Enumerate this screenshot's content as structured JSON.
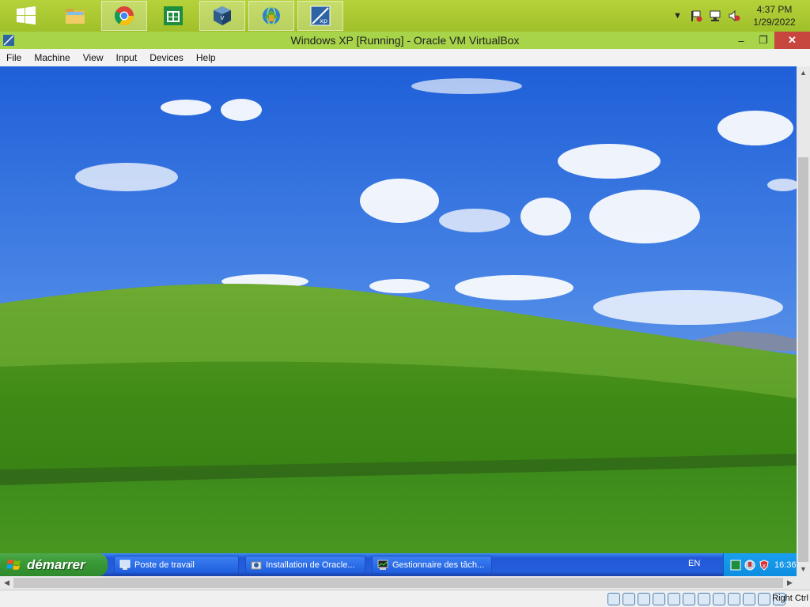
{
  "host_taskbar": {
    "apps": [
      {
        "name": "start-button",
        "icon": "windows-logo-icon"
      },
      {
        "name": "file-explorer",
        "icon": "folder-icon"
      },
      {
        "name": "chrome",
        "icon": "chrome-icon"
      },
      {
        "name": "store",
        "icon": "store-icon"
      },
      {
        "name": "virtualbox",
        "icon": "virtualbox-icon"
      },
      {
        "name": "idm",
        "icon": "globe-download-icon"
      },
      {
        "name": "windows-xp-vm",
        "icon": "xp-vm-icon"
      }
    ],
    "clock_time": "4:37 PM",
    "clock_date": "1/29/2022"
  },
  "window": {
    "title": "Windows XP [Running] - Oracle VM VirtualBox",
    "minimize": "–",
    "restore": "❐",
    "close": "✕"
  },
  "menu": {
    "file": "File",
    "machine": "Machine",
    "view": "View",
    "input": "Input",
    "devices": "Devices",
    "help": "Help"
  },
  "xp": {
    "start_label": "démarrer",
    "tasks": [
      {
        "label": "Poste de travail"
      },
      {
        "label": "Installation de Oracle..."
      },
      {
        "label": "Gestionnaire des tâch..."
      }
    ],
    "language": "EN",
    "clock": "16:36"
  },
  "status": {
    "host_key": "Right Ctrl"
  },
  "colors": {
    "host_accent": "#a8d44a",
    "xp_taskbar": "#245edb",
    "xp_start": "#3a9a36",
    "close_button": "#c7463d"
  }
}
